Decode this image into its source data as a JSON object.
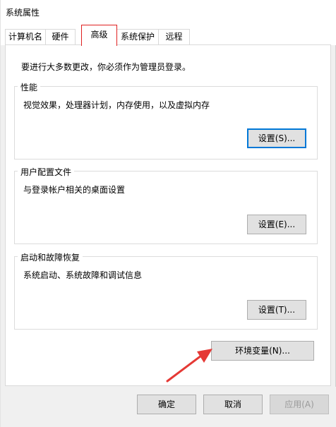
{
  "window": {
    "title": "系统属性"
  },
  "tabs": [
    {
      "label": "计算机名"
    },
    {
      "label": "硬件"
    },
    {
      "label": "高级"
    },
    {
      "label": "系统保护"
    },
    {
      "label": "远程"
    }
  ],
  "advanced": {
    "intro": "要进行大多数更改，你必须作为管理员登录。",
    "performance": {
      "title": "性能",
      "desc": "视觉效果，处理器计划，内存使用，以及虚拟内存",
      "button": "设置(S)..."
    },
    "user_profiles": {
      "title": "用户配置文件",
      "desc": "与登录帐户相关的桌面设置",
      "button": "设置(E)..."
    },
    "startup_recovery": {
      "title": "启动和故障恢复",
      "desc": "系统启动、系统故障和调试信息",
      "button": "设置(T)..."
    },
    "env_button": "环境变量(N)..."
  },
  "footer": {
    "ok": "确定",
    "cancel": "取消",
    "apply": "应用(A)"
  },
  "colors": {
    "tab_highlight": "#e02020",
    "arrow": "#e53935",
    "focus": "#0078d7"
  },
  "icons": {
    "annotation": "arrow-icon"
  }
}
